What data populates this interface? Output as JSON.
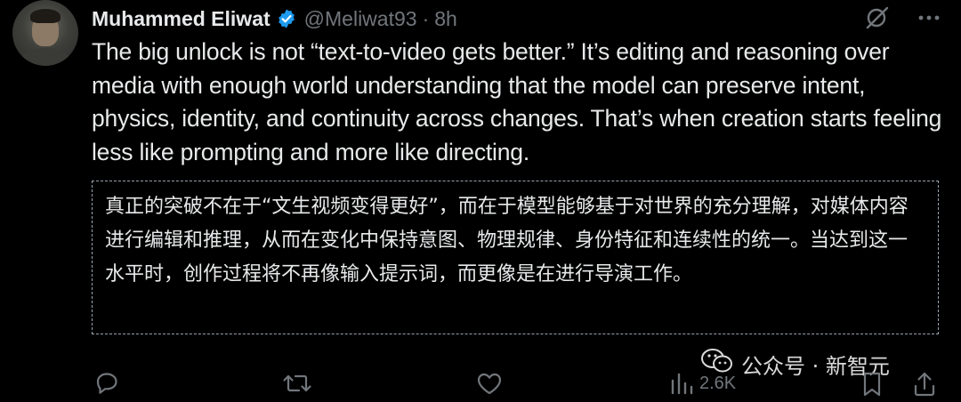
{
  "author": {
    "name": "Muhammed Eliwat",
    "handle": "@Meliwat93",
    "separator": "·",
    "time": "8h",
    "verified_color": "#1d9bf0"
  },
  "tweet": {
    "text": "The big unlock is not “text-to-video gets better.” It’s editing and reasoning over media with enough world understanding that the model can preserve intent, physics, identity, and continuity across changes. That’s when creation starts feeling less like prompting and more like directing.",
    "translation": "真正的突破不在于“文生视频变得更好”，而在于模型能够基于对世界的充分理解，对媒体内容进行编辑和推理，从而在变化中保持意图、物理规律、身份特征和连续性的统一。当达到这一水平时，创作过程将不再像输入提示词，而更像是在进行导演工作。"
  },
  "actions": {
    "views": "2.6K"
  },
  "watermark": {
    "text": "公众号 · 新智元"
  },
  "icons": {
    "grok": "grok-icon",
    "more": "more-icon",
    "reply": "reply-icon",
    "retweet": "retweet-icon",
    "like": "like-icon",
    "views": "views-icon",
    "bookmark": "bookmark-icon",
    "share": "share-icon",
    "wechat": "wechat-icon"
  },
  "colors": {
    "background": "#000000",
    "text": "#e7e9ea",
    "muted": "#71767b",
    "accent": "#1d9bf0"
  }
}
